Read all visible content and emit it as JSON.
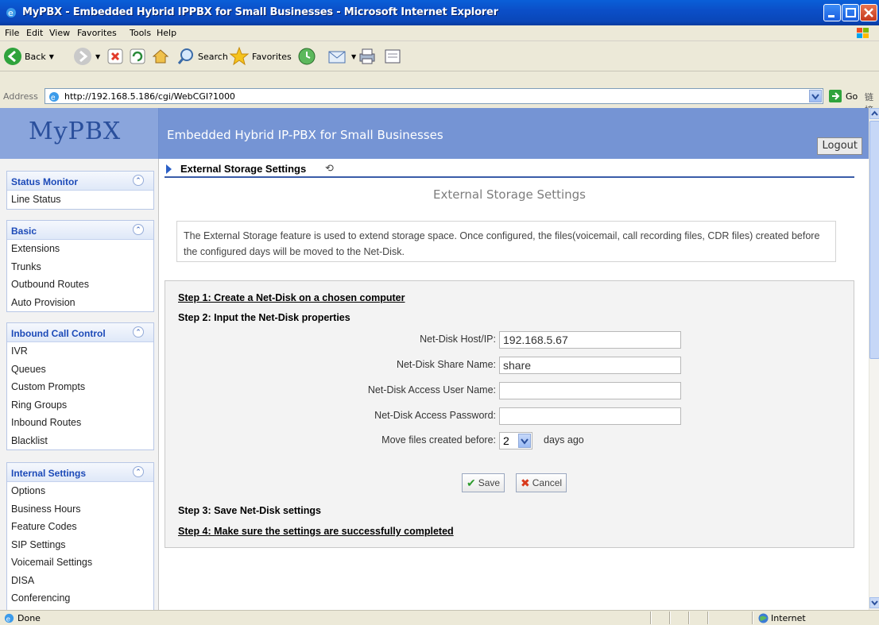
{
  "window": {
    "title": "MyPBX - Embedded Hybrid IPPBX for Small Businesses - Microsoft Internet Explorer"
  },
  "menu": [
    "File",
    "Edit",
    "View",
    "Favorites",
    "Tools",
    "Help"
  ],
  "toolbar": {
    "back_label": "Back",
    "search_label": "Search",
    "favorites_label": "Favorites"
  },
  "address": {
    "label": "Address",
    "url": "http://192.168.5.186/cgi/WebCGI?1000",
    "go_label": "Go",
    "links_label": "链接"
  },
  "header": {
    "logo": "MyPBX",
    "title": "Embedded Hybrid IP-PBX for Small Businesses",
    "logout_label": "Logout"
  },
  "sidebar": {
    "sections": [
      {
        "title": "Status Monitor",
        "items": [
          "Line Status"
        ]
      },
      {
        "title": "Basic",
        "items": [
          "Extensions",
          "Trunks",
          "Outbound Routes",
          "Auto Provision"
        ]
      },
      {
        "title": "Inbound Call Control",
        "items": [
          "IVR",
          "Queues",
          "Custom Prompts",
          "Ring Groups",
          "Inbound Routes",
          "Blacklist"
        ]
      },
      {
        "title": "Internal Settings",
        "items": [
          "Options",
          "Business Hours",
          "Feature Codes",
          "SIP Settings",
          "Voicemail Settings",
          "DISA",
          "Conferencing"
        ]
      }
    ]
  },
  "main": {
    "breadcrumb": "External Storage Settings",
    "page_title": "External Storage Settings",
    "info": "The External Storage feature is used to extend storage space. Once configured, the files(voicemail, call recording files, CDR files) created before the configured days will be moved to the Net-Disk.",
    "step1": "Step 1: Create a Net-Disk on a chosen computer",
    "step2": "Step 2: Input the Net-Disk properties",
    "step3": "Step 3: Save Net-Disk settings",
    "step4": "Step 4: Make sure the settings are successfully completed",
    "fields": {
      "host_label": "Net-Disk Host/IP:",
      "host_value": "192.168.5.67",
      "share_label": "Net-Disk Share Name:",
      "share_value": "share",
      "user_label": "Net-Disk Access User Name:",
      "user_value": "",
      "password_label": "Net-Disk Access Password:",
      "password_value": "",
      "move_label": "Move files created before:",
      "move_value": "2",
      "move_suffix": "days ago"
    },
    "save_label": "Save",
    "cancel_label": "Cancel"
  },
  "statusbar": {
    "status": "Done",
    "zone": "Internet"
  }
}
